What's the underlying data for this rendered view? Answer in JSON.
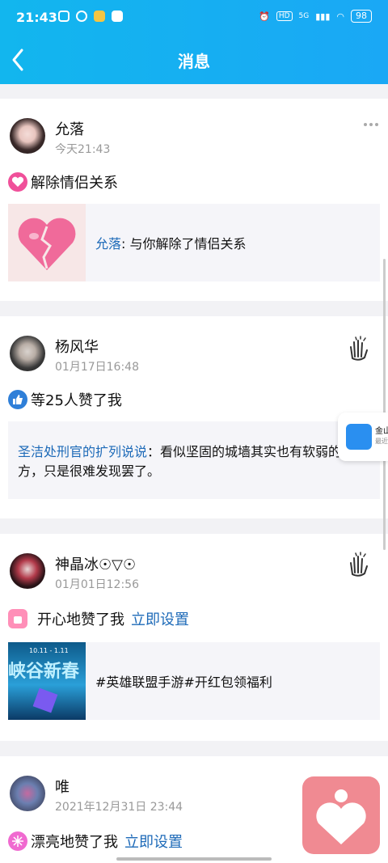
{
  "status_bar": {
    "time": "21:43",
    "hd": "HD",
    "net": "5G",
    "battery": "98"
  },
  "header": {
    "title": "消息"
  },
  "cards": [
    {
      "name": "允落",
      "time": "今天21:43",
      "action": "解除情侣关系",
      "quote_name": "允落",
      "quote_text": ": 与你解除了情侣关系"
    },
    {
      "name": "杨风华",
      "time": "01月17日16:48",
      "action": "等25人赞了我",
      "quote_line1_name": "圣洁处刑官的扩列说说",
      "quote_line1_text": "：看似坚固的城墙其实也有软弱的地",
      "quote_line2": "方，只是很难发现罢了。"
    },
    {
      "name": "神晶冰☉▽☉",
      "time": "01月01日12:56",
      "action": "开心地赞了我",
      "action_link": "立即设置",
      "thumb_date": "10.11 - 1.11",
      "thumb_title": "峡谷新春",
      "quote_text": "#英雄联盟手游#开红包领福利"
    },
    {
      "name": "唯",
      "time": "2021年12月31日 23:44",
      "action": "漂亮地赞了我",
      "action_link": "立即设置"
    }
  ],
  "side_widget": {
    "label": "金山",
    "sub": "最近"
  },
  "colors": {
    "header": "#1aa8f5",
    "link": "#1d6ab8",
    "heart_button": "#f08a92"
  }
}
